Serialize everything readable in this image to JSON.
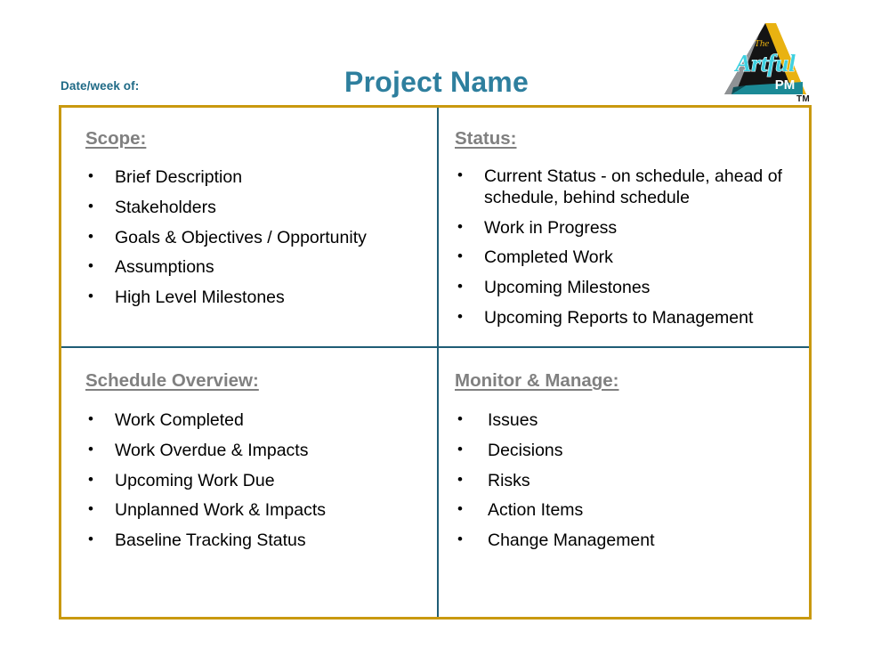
{
  "header": {
    "date_label": "Date/week of:",
    "title": "Project Name",
    "title_color": "#2e7f9e",
    "date_color": "#1f6a86"
  },
  "logo": {
    "brand_the": "The",
    "brand_name": "Artful",
    "brand_pm": "PM",
    "trademark": "TM",
    "triangle_fill": "#141414",
    "left_edge_color": "#8f9295",
    "right_edge_color": "#e9b211",
    "script_color": "#3fd0e0",
    "base_color": "#1b8a96"
  },
  "grid": {
    "border_color": "#c9990f",
    "divider_color": "#1f5d75",
    "heading_color": "#808080",
    "body_color": "#000000"
  },
  "quadrants": [
    {
      "id": "scope",
      "heading": "Scope:",
      "items": [
        "Brief Description",
        "Stakeholders",
        "Goals & Objectives / Opportunity",
        "Assumptions",
        "High Level Milestones"
      ]
    },
    {
      "id": "status",
      "heading": "Status:",
      "items": [
        "Current Status - on schedule, ahead of schedule, behind schedule",
        "Work in Progress",
        "Completed Work",
        "Upcoming Milestones",
        "Upcoming Reports to Management"
      ]
    },
    {
      "id": "schedule-overview",
      "heading": "Schedule Overview:",
      "items": [
        "Work Completed",
        "Work Overdue & Impacts",
        "Upcoming Work Due",
        "Unplanned Work & Impacts",
        "Baseline Tracking Status"
      ]
    },
    {
      "id": "monitor-manage",
      "heading": "Monitor & Manage:",
      "items": [
        "Issues",
        "Decisions",
        "Risks",
        "Action Items",
        "Change Management"
      ]
    }
  ]
}
